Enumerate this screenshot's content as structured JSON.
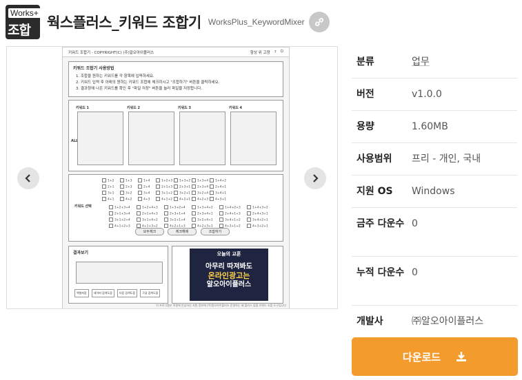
{
  "header": {
    "logo_top": "Works+",
    "logo_bottom": "조합기",
    "title": "웍스플러스_키워드 조합기",
    "subtitle": "WorksPlus_KeywordMixer"
  },
  "app": {
    "titlebar": "키워드 조합기 - COPYRIGHT(C) (주)알오아이플러스",
    "always_on_top": "항상 위 고정",
    "help": "?",
    "usage_title": "키워드 조합기 사용방법",
    "usage_lines": [
      "1. 조합을 원하는 키워드를 각 항목에 입력하세요.",
      "2. 키워드 입력 후 아래의 원하는 키워드 조합에 체크하시고 \"조합하기\" 버튼을 클릭하세요.",
      "3. 결과창에 나온 키워드를 확인 후 \"파일 저장\" 버튼을 눌러 파일을 저장합니다."
    ],
    "keyword_labels": [
      "키워드 1",
      "키워드 2",
      "키워드 3",
      "키워드 4"
    ],
    "all_label": "ALL",
    "select_label": "키워드 선택",
    "combos_row1": [
      "1+2",
      "1+3",
      "1+4",
      "1+2+3",
      "1+3+2",
      "1+3+4",
      "1+4+2",
      "2+1",
      "2+3",
      "2+4",
      "2+1+3",
      "2+3+1",
      "2+3+4",
      "2+4+1",
      "3+1",
      "3+2",
      "3+4",
      "3+1+2",
      "3+2+1",
      "3+2+4",
      "3+4+1",
      "4+1",
      "4+2",
      "4+3",
      "4+1+2",
      "4+2+1",
      "4+2+3",
      "4+3+1"
    ],
    "combos_row2": [
      "1+2+3+4",
      "1+2+4+3",
      "1+3+2+4",
      "1+3+4+2",
      "1+4+2+3",
      "1+4+3+2",
      "2+1+3+4",
      "2+1+4+3",
      "2+3+1+4",
      "2+3+4+1",
      "2+4+1+3",
      "2+4+3+1",
      "3+1+2+4",
      "3+1+4+2",
      "3+2+1+4",
      "3+2+4+1",
      "3+4+1+2",
      "3+4+2+1",
      "4+1+2+3",
      "4+1+3+2",
      "4+2+1+3",
      "4+2+3+1",
      "4+3+1+2",
      "4+3+2+1"
    ],
    "btn_all": "모두체크",
    "btn_clear": "체크해제",
    "btn_combine": "조합하기",
    "result_title": "결과보기",
    "bottom_btns": [
      "엑셀저장",
      "네이버 검색도움",
      "다음 검색도움",
      "구글 검색도움"
    ],
    "ad_title": "오늘의 교훈",
    "ad_line1": "아무리 따져봐도",
    "ad_line2": "온라인광고는",
    "ad_line3": "알오아이플러스",
    "footer": "이 프로그램은 학원에 안심하신 지원 정보에 (주)알오아이플러스 운영하는 제 플러스 등합 키워드 조합 도구입니다"
  },
  "info": [
    {
      "k": "분류",
      "v": "업무"
    },
    {
      "k": "버전",
      "v": "v1.0.0"
    },
    {
      "k": "용량",
      "v": "1.60MB"
    },
    {
      "k": "사용범위",
      "v": "프리 - 개인, 국내"
    },
    {
      "k": "지원 OS",
      "v": "Windows"
    },
    {
      "k": "금주 다운수",
      "v": "0"
    },
    {
      "k": "누적 다운수",
      "v": "0"
    },
    {
      "k": "개발사",
      "v": "㈜알오아이플러스"
    }
  ],
  "download_label": "다운로드",
  "colors": {
    "accent": "#f49b2e",
    "link": "#555555"
  }
}
